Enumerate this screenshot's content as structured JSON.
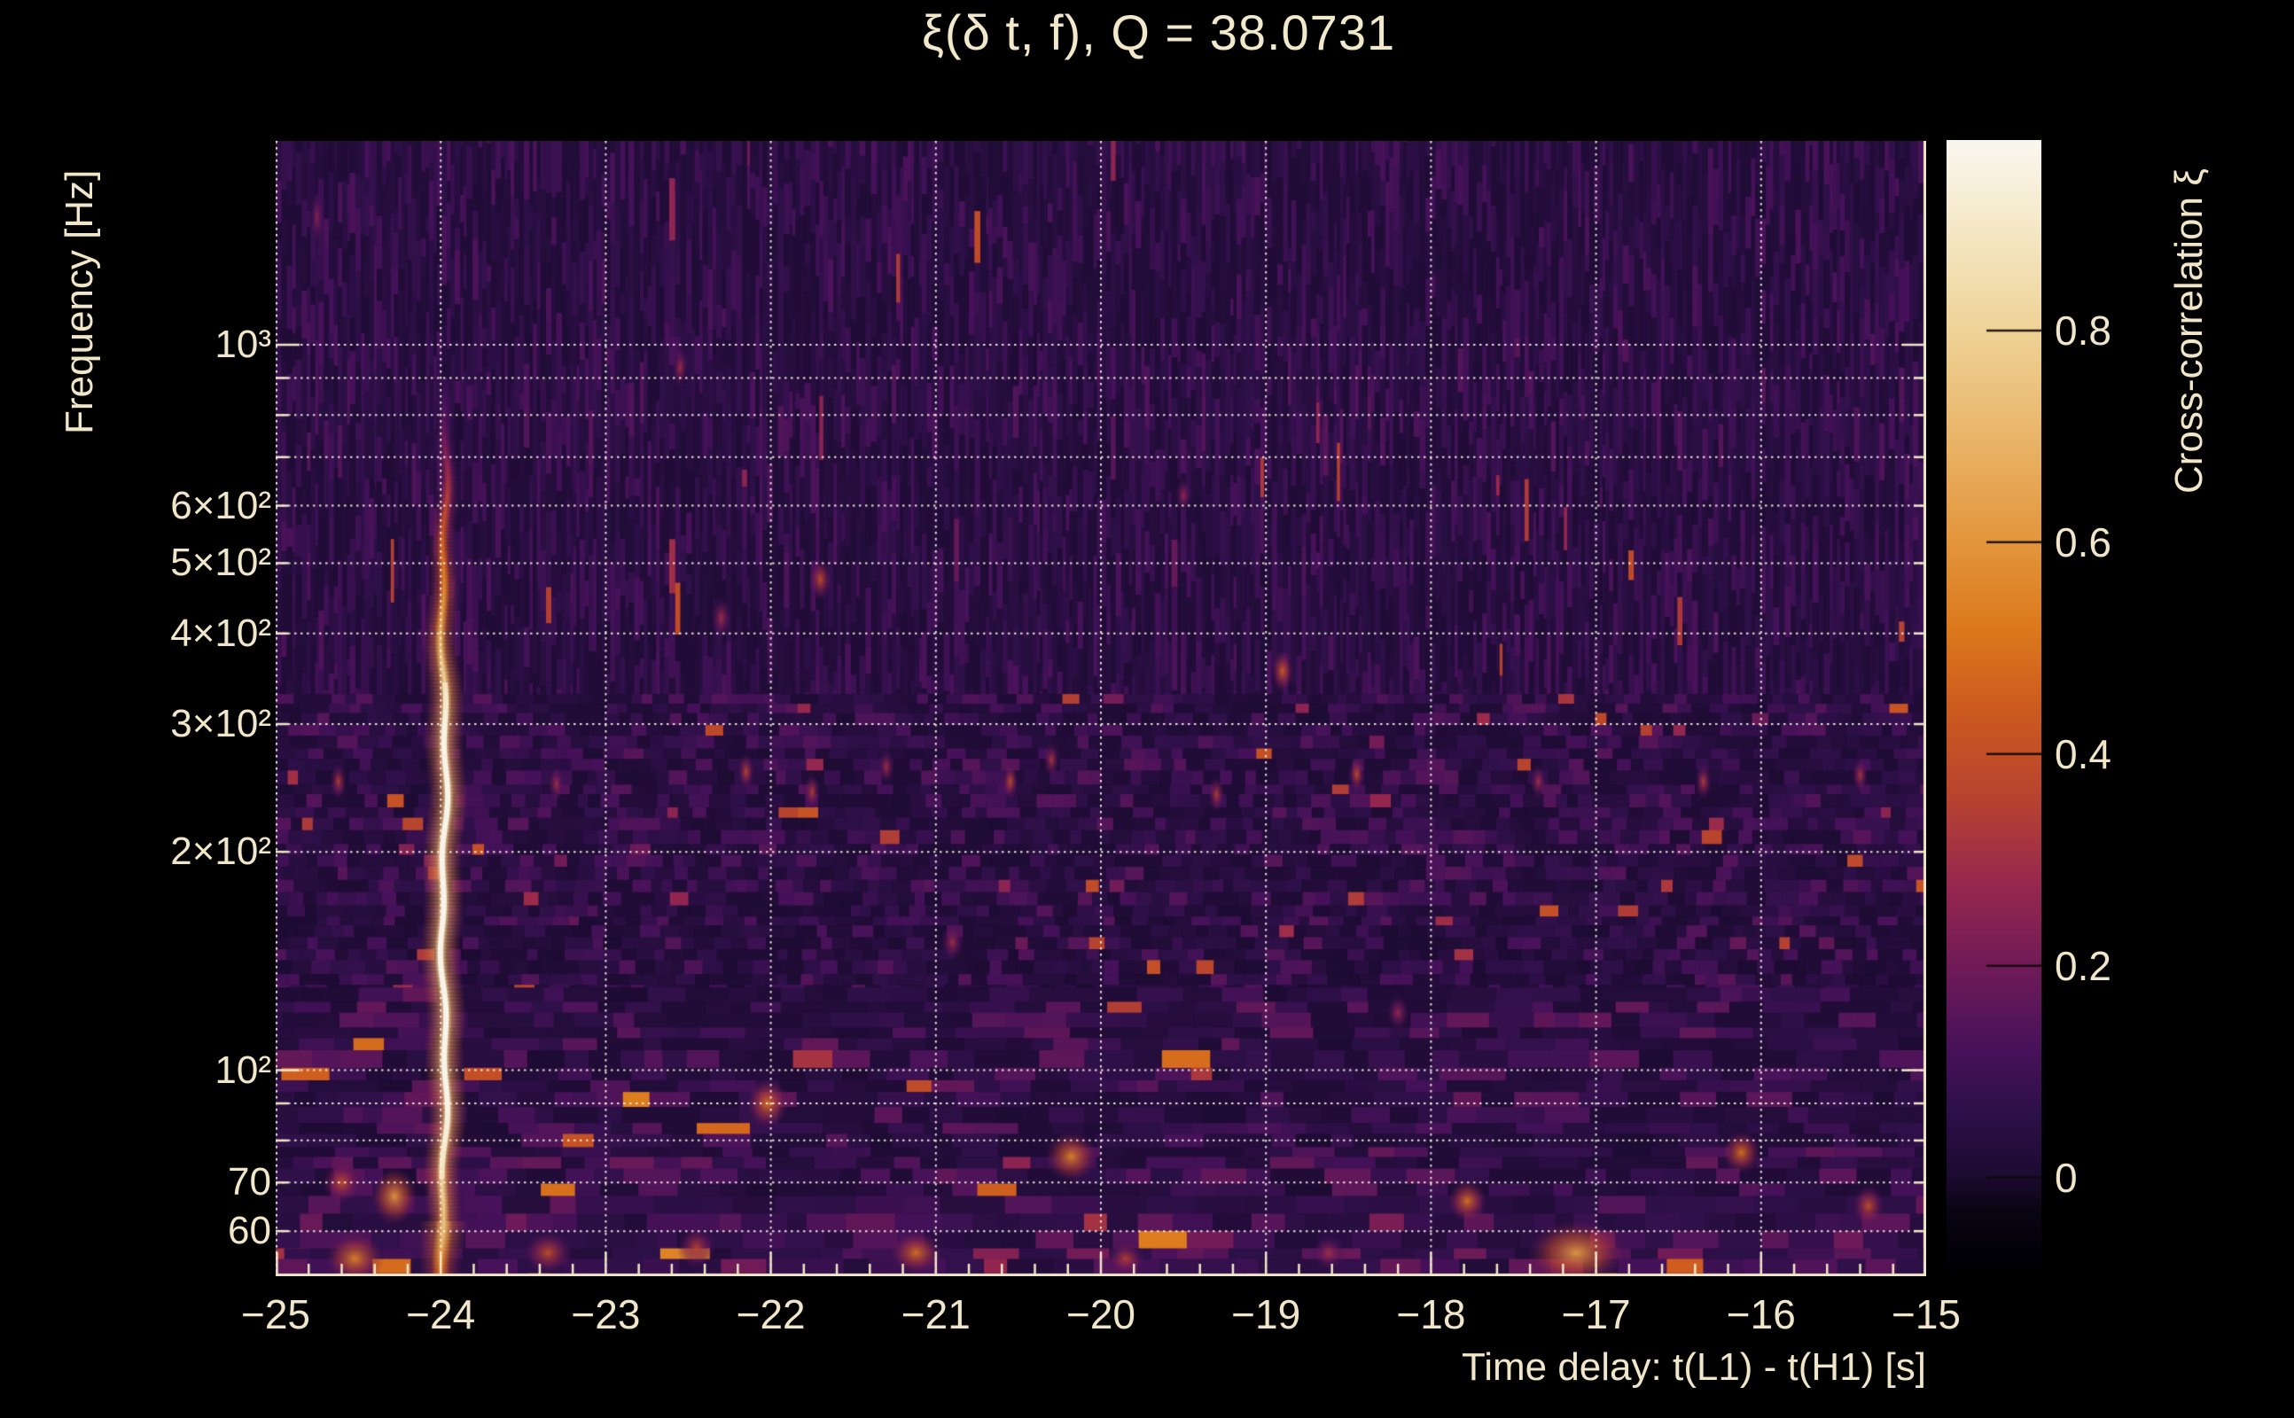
{
  "title": "ξ(δ t, f), Q = 38.0731",
  "axes": {
    "x_label": "Time delay: t(L1) - t(H1) [s]",
    "y_label": "Frequency [Hz]",
    "colorbar_label": "Cross-correlation ξ"
  },
  "chart_data": {
    "type": "heatmap",
    "title": "ξ(δ t, f), Q = 38.0731",
    "Q": 38.0731,
    "xlabel": "Time delay: t(L1) - t(H1) [s]",
    "ylabel": "Frequency [Hz]",
    "colorbar_label": "Cross-correlation ξ",
    "x_range": [
      -25,
      -15
    ],
    "x_ticks": [
      {
        "t": -25,
        "label": "−25"
      },
      {
        "t": -24,
        "label": "−24"
      },
      {
        "t": -23,
        "label": "−23"
      },
      {
        "t": -22,
        "label": "−22"
      },
      {
        "t": -21,
        "label": "−21"
      },
      {
        "t": -20,
        "label": "−20"
      },
      {
        "t": -19,
        "label": "−19"
      },
      {
        "t": -18,
        "label": "−18"
      },
      {
        "t": -17,
        "label": "−17"
      },
      {
        "t": -16,
        "label": "−16"
      },
      {
        "t": -15,
        "label": "−15"
      }
    ],
    "x_minor_tick_step": 0.2,
    "y_scale": "log",
    "y_range": [
      52,
      1910
    ],
    "y_ticks": [
      {
        "f": 1000,
        "label": "10³"
      },
      {
        "f": 600,
        "label": "6×10²"
      },
      {
        "f": 500,
        "label": "5×10²"
      },
      {
        "f": 400,
        "label": "4×10²"
      },
      {
        "f": 300,
        "label": "3×10²"
      },
      {
        "f": 200,
        "label": "2×10²"
      },
      {
        "f": 100,
        "label": "10²"
      },
      {
        "f": 70,
        "label": "70"
      },
      {
        "f": 60,
        "label": "60"
      }
    ],
    "y_gridlines": [
      60,
      70,
      80,
      90,
      100,
      200,
      300,
      400,
      500,
      600,
      700,
      800,
      900,
      1000
    ],
    "grid_on": true,
    "colorbar": {
      "vmin": -0.09,
      "vmax": 0.98,
      "ticks": [
        {
          "v": 0.8,
          "label": "0.8"
        },
        {
          "v": 0.6,
          "label": "0.6"
        },
        {
          "v": 0.4,
          "label": "0.4"
        },
        {
          "v": 0.2,
          "label": "0.2"
        },
        {
          "v": 0.0,
          "label": "0"
        }
      ],
      "colormap_stops": [
        [
          -0.09,
          "#000003"
        ],
        [
          -0.03,
          "#0b0514"
        ],
        [
          0.0,
          "#1c0b31"
        ],
        [
          0.06,
          "#2e1048"
        ],
        [
          0.12,
          "#47125a"
        ],
        [
          0.2,
          "#711b58"
        ],
        [
          0.28,
          "#99294e"
        ],
        [
          0.36,
          "#b8442f"
        ],
        [
          0.44,
          "#cd5a20"
        ],
        [
          0.52,
          "#dc7a1c"
        ],
        [
          0.6,
          "#e3963c"
        ],
        [
          0.7,
          "#e9b569"
        ],
        [
          0.8,
          "#efd397"
        ],
        [
          0.9,
          "#f5e9c8"
        ],
        [
          0.98,
          "#faf7f0"
        ]
      ]
    },
    "signal_streak": {
      "t": -23.98,
      "profile": [
        [
          52,
          0.5
        ],
        [
          58,
          0.72
        ],
        [
          66,
          0.82
        ],
        [
          80,
          0.9
        ],
        [
          95,
          0.95
        ],
        [
          130,
          0.97
        ],
        [
          200,
          0.96
        ],
        [
          300,
          0.93
        ],
        [
          360,
          0.82
        ],
        [
          430,
          0.65
        ],
        [
          520,
          0.5
        ],
        [
          620,
          0.36
        ],
        [
          750,
          0.2
        ],
        [
          900,
          0.08
        ]
      ]
    },
    "blobs": [
      {
        "t": -24.52,
        "f": 55,
        "xi": 0.55,
        "dt": 0.18,
        "dfl": 0.035
      },
      {
        "t": -24.28,
        "f": 67,
        "xi": 0.6,
        "dt": 0.14,
        "dfl": 0.04
      },
      {
        "t": -24.6,
        "f": 70,
        "xi": 0.4,
        "dt": 0.12,
        "dfl": 0.03
      },
      {
        "t": -23.35,
        "f": 56,
        "xi": 0.4,
        "dt": 0.15,
        "dfl": 0.03
      },
      {
        "t": -22.45,
        "f": 57,
        "xi": 0.35,
        "dt": 0.12,
        "dfl": 0.03
      },
      {
        "t": -22.02,
        "f": 90,
        "xi": 0.5,
        "dt": 0.13,
        "dfl": 0.035
      },
      {
        "t": -21.12,
        "f": 56,
        "xi": 0.5,
        "dt": 0.16,
        "dfl": 0.03
      },
      {
        "t": -20.18,
        "f": 76,
        "xi": 0.55,
        "dt": 0.16,
        "dfl": 0.035
      },
      {
        "t": -19.85,
        "f": 55,
        "xi": 0.35,
        "dt": 0.12,
        "dfl": 0.025
      },
      {
        "t": -18.62,
        "f": 56,
        "xi": 0.3,
        "dt": 0.1,
        "dfl": 0.025
      },
      {
        "t": -17.78,
        "f": 66,
        "xi": 0.5,
        "dt": 0.12,
        "dfl": 0.03
      },
      {
        "t": -17.12,
        "f": 56,
        "xi": 0.62,
        "dt": 0.3,
        "dfl": 0.045
      },
      {
        "t": -16.12,
        "f": 77,
        "xi": 0.5,
        "dt": 0.12,
        "dfl": 0.03
      },
      {
        "t": -15.35,
        "f": 65,
        "xi": 0.4,
        "dt": 0.1,
        "dfl": 0.03
      },
      {
        "t": -21.7,
        "f": 475,
        "xi": 0.4,
        "dt": 0.07,
        "dfl": 0.03
      },
      {
        "t": -22.3,
        "f": 420,
        "xi": 0.3,
        "dt": 0.06,
        "dfl": 0.03
      },
      {
        "t": -18.9,
        "f": 355,
        "xi": 0.45,
        "dt": 0.07,
        "dfl": 0.03
      },
      {
        "t": -22.55,
        "f": 930,
        "xi": 0.3,
        "dt": 0.05,
        "dfl": 0.03
      },
      {
        "t": -24.75,
        "f": 1500,
        "xi": 0.25,
        "dt": 0.04,
        "dfl": 0.04
      },
      {
        "t": -19.5,
        "f": 620,
        "xi": 0.28,
        "dt": 0.05,
        "dfl": 0.025
      },
      {
        "t": -20.9,
        "f": 150,
        "xi": 0.3,
        "dt": 0.07,
        "dfl": 0.025
      },
      {
        "t": -18.2,
        "f": 120,
        "xi": 0.28,
        "dt": 0.07,
        "dfl": 0.025
      },
      {
        "t": -24.62,
        "f": 250,
        "xi": 0.35,
        "dt": 0.05,
        "dfl": 0.025
      },
      {
        "t": -23.3,
        "f": 248,
        "xi": 0.3,
        "dt": 0.05,
        "dfl": 0.025
      },
      {
        "t": -22.15,
        "f": 258,
        "xi": 0.38,
        "dt": 0.05,
        "dfl": 0.025
      },
      {
        "t": -21.75,
        "f": 242,
        "xi": 0.35,
        "dt": 0.05,
        "dfl": 0.025
      },
      {
        "t": -21.3,
        "f": 262,
        "xi": 0.3,
        "dt": 0.05,
        "dfl": 0.025
      },
      {
        "t": -20.55,
        "f": 250,
        "xi": 0.4,
        "dt": 0.05,
        "dfl": 0.025
      },
      {
        "t": -20.3,
        "f": 268,
        "xi": 0.33,
        "dt": 0.05,
        "dfl": 0.025
      },
      {
        "t": -19.3,
        "f": 240,
        "xi": 0.35,
        "dt": 0.05,
        "dfl": 0.025
      },
      {
        "t": -18.45,
        "f": 256,
        "xi": 0.4,
        "dt": 0.05,
        "dfl": 0.025
      },
      {
        "t": -17.35,
        "f": 250,
        "xi": 0.3,
        "dt": 0.05,
        "dfl": 0.025
      },
      {
        "t": -16.35,
        "f": 250,
        "xi": 0.35,
        "dt": 0.05,
        "dfl": 0.025
      },
      {
        "t": -15.4,
        "f": 255,
        "xi": 0.33,
        "dt": 0.05,
        "dfl": 0.025
      }
    ],
    "noise_texture": {
      "seed": 20240217,
      "zones": [
        {
          "name": "high-band-striae",
          "f_from": 330,
          "f_to": 1910,
          "cell_w": [
            3,
            7
          ],
          "cell_h": [
            18,
            73
          ],
          "v_base": 0.015,
          "v_spread": 0.115,
          "accent_p": 0.005,
          "accent_v": [
            0.17,
            0.39
          ]
        },
        {
          "name": "mid-band-blocks",
          "f_from": 130,
          "f_to": 330,
          "cell_w": [
            11,
            24
          ],
          "cell_h": [
            9,
            16
          ],
          "v_base": 0.012,
          "v_spread": 0.14,
          "accent_p": 0.018,
          "accent_v": [
            0.18,
            0.42
          ]
        },
        {
          "name": "low-band-blobs",
          "f_from": 52,
          "f_to": 130,
          "cell_w": [
            20,
            56
          ],
          "cell_h": [
            11,
            20
          ],
          "v_base": 0.015,
          "v_spread": 0.16,
          "accent_p": 0.02,
          "accent_v": [
            0.26,
            0.54
          ]
        }
      ]
    }
  },
  "style": {
    "background": "#000000",
    "text_color": "#f1e7c8",
    "grid_color": "#f9f4e3",
    "accent_bright": "#faf7f0"
  }
}
